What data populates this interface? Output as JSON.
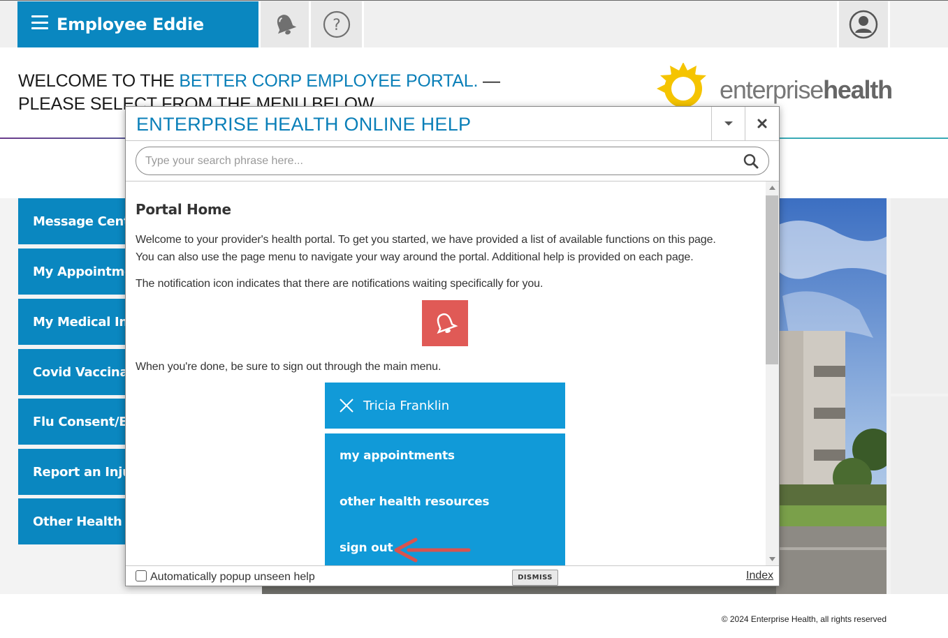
{
  "header": {
    "app_title": "Employee Eddie",
    "menu_icon": "hamburger-icon",
    "notification_icon": "bell-icon",
    "help_icon": "question-circle-icon",
    "profile_icon": "user-avatar-icon"
  },
  "welcome": {
    "line1_prefix": "WELCOME TO THE ",
    "line1_highlight": "BETTER CORP EMPLOYEE PORTAL.",
    "line1_suffix": " —",
    "line2": "PLEASE SELECT FROM THE MENU BELOW"
  },
  "logo": {
    "word_light": "enterprise",
    "word_bold": "health"
  },
  "menu": {
    "items": [
      {
        "label": "Message Center"
      },
      {
        "label": "My Appointments"
      },
      {
        "label": "My Medical Information"
      },
      {
        "label": "Covid Vaccination"
      },
      {
        "label": "Flu Consent/Exemption"
      },
      {
        "label": "Report an Injury"
      },
      {
        "label": "Other Health Resources"
      }
    ]
  },
  "footer": {
    "copyright": "© 2024 Enterprise Health, all rights reserved"
  },
  "help_dialog": {
    "title": "ENTERPRISE HEALTH ONLINE HELP",
    "search_placeholder": "Type your search phrase here...",
    "heading": "Portal Home",
    "para1_line1": "Welcome to your provider's health portal. To get you started, we have provided a list of available functions on this page.",
    "para1_line2": "You can also use the page menu to navigate your way around the portal. Additional help is provided on each page.",
    "para2": "The notification icon indicates that there are notifications waiting specifically for you.",
    "para3": "When you're done, be sure to sign out through the main menu.",
    "example_user_name": "Tricia Franklin",
    "example_menu_items": [
      "my appointments",
      "other health resources",
      "sign out"
    ],
    "auto_popup_label": "Automatically popup unseen help",
    "dismiss_label": "DISMISS",
    "index_label": "Index"
  },
  "colors": {
    "brand_blue": "#0a87c0",
    "notification_red": "#e05a56",
    "screenshot_blue": "#119ad8",
    "arrow_red": "#d9534f"
  }
}
